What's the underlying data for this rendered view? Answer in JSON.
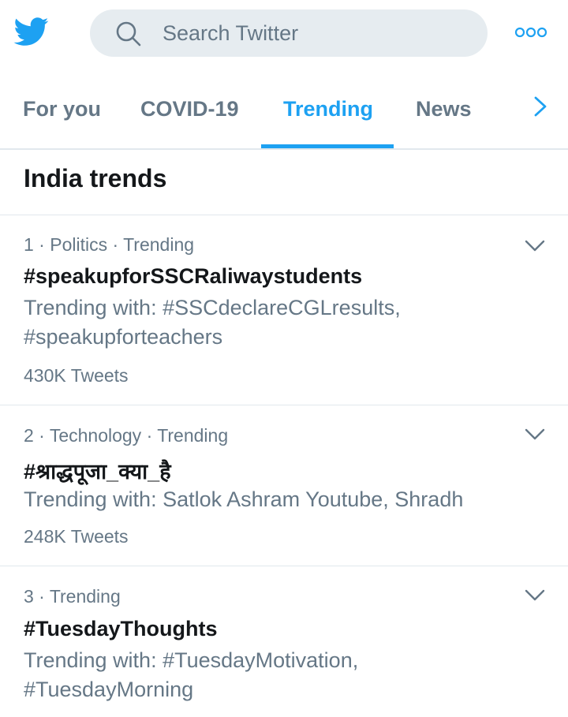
{
  "header": {
    "search": {
      "placeholder": "Search Twitter",
      "value": ""
    },
    "logo_icon": "twitter-bird-icon",
    "more_icon": "more-dots-icon",
    "brand_color": "#1da1f2"
  },
  "tabs": {
    "items": [
      {
        "label": "For you",
        "active": false
      },
      {
        "label": "COVID-19",
        "active": false
      },
      {
        "label": "Trending",
        "active": true
      },
      {
        "label": "News",
        "active": false
      }
    ],
    "next_icon": "chevron-right-icon"
  },
  "section": {
    "title": "India trends"
  },
  "trends": [
    {
      "meta": "1 · Politics · Trending",
      "name": "#speakupforSSCRaliwaystudents",
      "with": "Trending with: #SSCdeclareCGLresults, #speakupforteachers",
      "count": "430K Tweets"
    },
    {
      "meta": "2 · Technology · Trending",
      "name": "#श्राद्धपूजा_क्या_है",
      "with": "Trending with: Satlok Ashram Youtube, Shradh",
      "count": "248K Tweets"
    },
    {
      "meta": "3 · Trending",
      "name": "#TuesdayThoughts",
      "with": "Trending with: #TuesdayMotivation, #TuesdayMorning",
      "count": ""
    }
  ],
  "colors": {
    "accent": "#1da1f2",
    "secondary_text": "#657786",
    "primary_text": "#14171a",
    "search_bg": "#e6ecf0",
    "divider": "#e1e8ed"
  }
}
